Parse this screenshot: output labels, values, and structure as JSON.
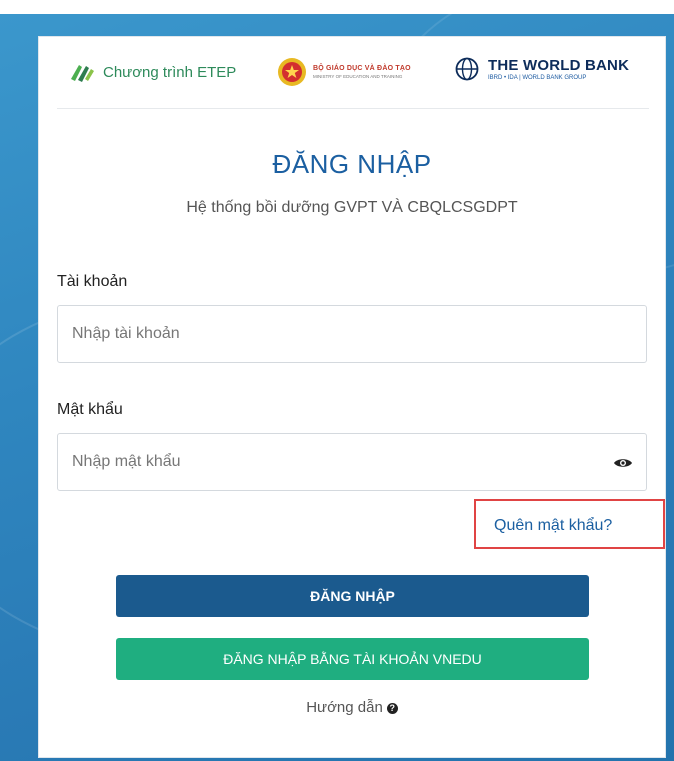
{
  "page": {
    "accent_color": "#1b5fa1",
    "background_color": "#2f86bf"
  },
  "logos": {
    "etep_text": "Chương trình ETEP",
    "moet_line1": "BỘ GIÁO DỤC VÀ ĐÀO TẠO",
    "moet_line2": "MINISTRY OF EDUCATION AND TRAINING",
    "worldbank_line1": "THE WORLD BANK",
    "worldbank_line2": "IBRD • IDA | WORLD BANK GROUP"
  },
  "login": {
    "title": "ĐĂNG NHẬP",
    "subtitle": "Hệ thống bồi dưỡng GVPT VÀ CBQLCSGDPT",
    "account_label": "Tài khoản",
    "account_placeholder": "Nhập tài khoản",
    "account_value": "",
    "password_label": "Mật khẩu",
    "password_placeholder": "Nhập mật khẩu",
    "password_value": "",
    "forgot_link": "Quên mật khẩu?",
    "login_button": "ĐĂNG NHẬP",
    "vnedu_button": "ĐĂNG NHẬP BẰNG TÀI KHOẢN VNEDU",
    "guide_link": "Hướng dẫn",
    "guide_icon": "?",
    "highlight_color": "#e04444"
  }
}
